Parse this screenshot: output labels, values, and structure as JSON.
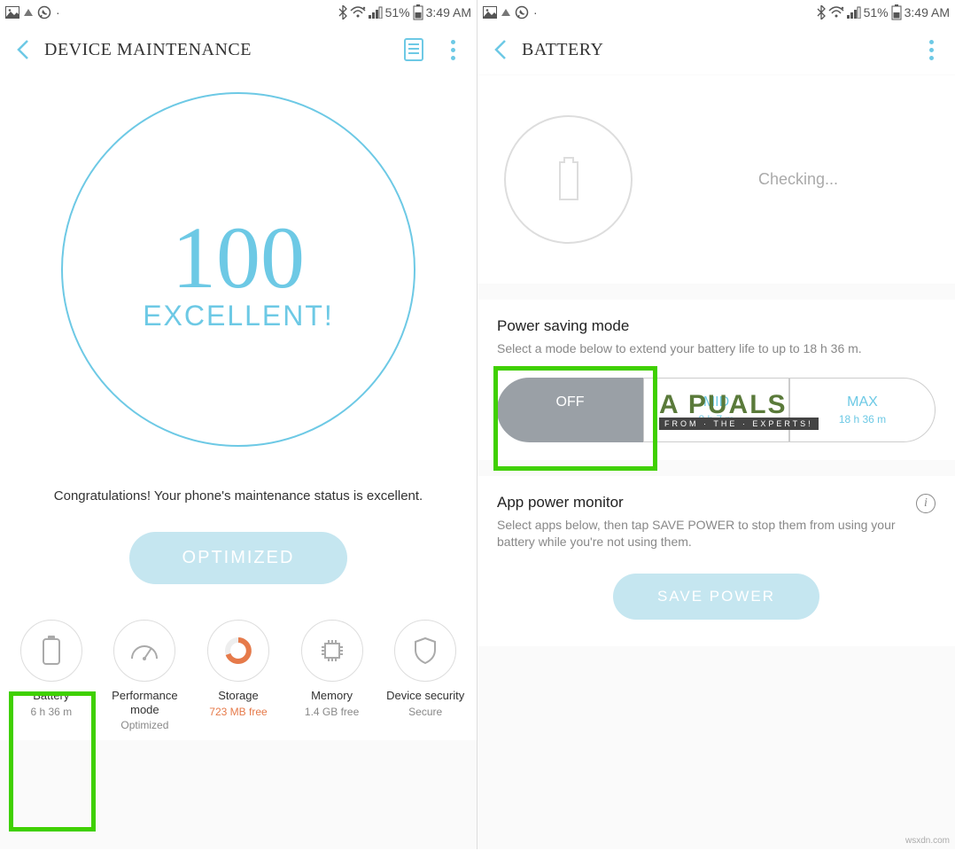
{
  "status": {
    "battery_pct": "51%",
    "time": "3:49 AM"
  },
  "left": {
    "title": "DEVICE MAINTENANCE",
    "score": "100",
    "score_word": "EXCELLENT!",
    "score_msg": "Congratulations! Your phone's maintenance status is excellent.",
    "optimized_btn": "OPTIMIZED",
    "categories": [
      {
        "label": "Battery",
        "sub": "6 h 36 m",
        "icon": "battery"
      },
      {
        "label": "Performance mode",
        "sub": "Optimized",
        "icon": "gauge"
      },
      {
        "label": "Storage",
        "sub": "723 MB free",
        "icon": "donut",
        "warn": true
      },
      {
        "label": "Memory",
        "sub": "1.4 GB free",
        "icon": "chip"
      },
      {
        "label": "Device security",
        "sub": "Secure",
        "icon": "shield"
      }
    ]
  },
  "right": {
    "title": "BATTERY",
    "checking": "Checking...",
    "psm_title": "Power saving mode",
    "psm_desc": "Select a mode below to extend your battery life to up to 18 h 36 m.",
    "psm_options": [
      {
        "main": "OFF",
        "sub": ""
      },
      {
        "main": "MID",
        "sub": "8 h 7 m"
      },
      {
        "main": "MAX",
        "sub": "18 h 36 m"
      }
    ],
    "apm_title": "App power monitor",
    "apm_desc": "Select apps below, then tap SAVE POWER to stop them from using your battery while you're not using them.",
    "save_power_btn": "SAVE POWER"
  },
  "watermark": "wsxdn.com",
  "overlay_logo": {
    "text": "A   PUALS",
    "sub": "FROM · THE · EXPERTS!"
  }
}
